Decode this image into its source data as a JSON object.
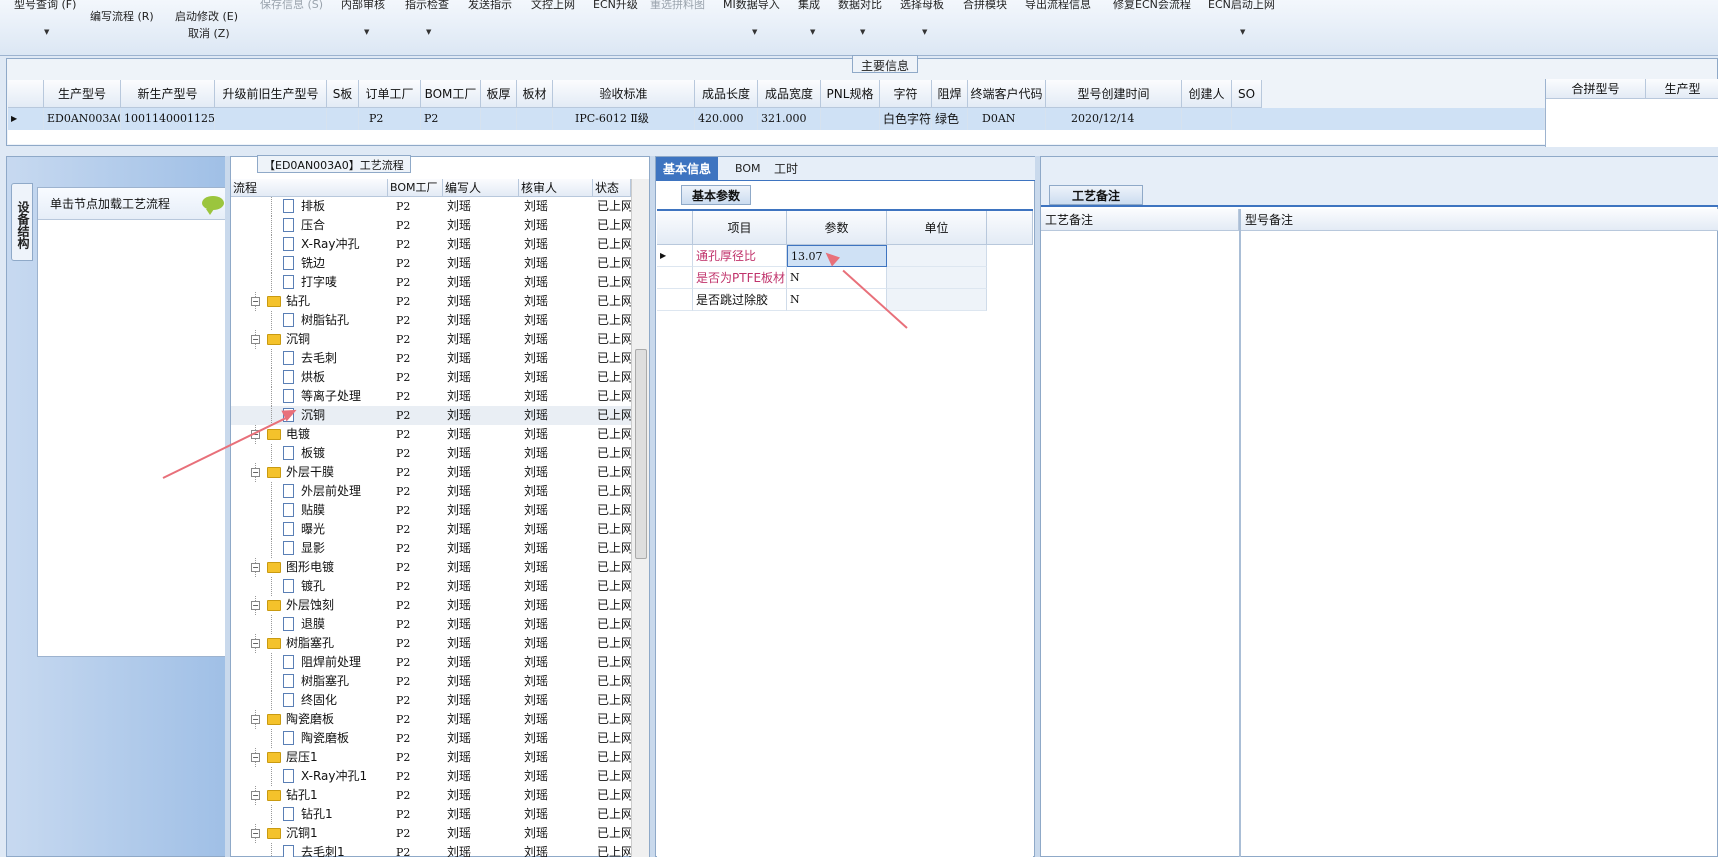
{
  "toolbar": {
    "items": [
      "型号查询 (F)",
      "编写流程 (R)",
      "启动修改 (E)",
      "取消 (Z)",
      "保存信息 (S)",
      "内部审核",
      "指示检查",
      "发送指示",
      "文控上网",
      "ECN升级",
      "重选拼料图",
      "MI数据导入",
      "集成",
      "数据对比",
      "选择母板",
      "合拼模块",
      "导出流程信息",
      "修复ECN会流程",
      "ECN启动上网"
    ]
  },
  "main_info": {
    "title": "主要信息",
    "columns": [
      "生产型号",
      "新生产型号",
      "升级前旧生产型号",
      "S板",
      "订单工厂",
      "BOM工厂",
      "板厚",
      "板材",
      "验收标准",
      "成品长度",
      "成品宽度",
      "PNL规格",
      "字符",
      "阻焊",
      "终端客户代码",
      "型号创建时间",
      "创建人",
      "SO"
    ],
    "row": [
      "ED0AN003A0",
      "10011400011252",
      "",
      "",
      "P2",
      "P2",
      "",
      "",
      "IPC-6012 Ⅱ级",
      "420.000",
      "321.000",
      "",
      "白色字符",
      "绿色",
      "D0AN",
      "2020/12/14",
      "",
      ""
    ],
    "merge_columns": [
      "合拼型号",
      "生产型"
    ]
  },
  "left_panel": {
    "vertical_tab": "设备结构",
    "load_hint": "单击节点加载工艺流程"
  },
  "tree": {
    "title": "【ED0AN003A0】工艺流程",
    "columns": [
      "流程",
      "BOM工厂",
      "编写人",
      "核审人",
      "状态"
    ],
    "rows": [
      {
        "name": "排板",
        "type": "doc",
        "bom": "P2",
        "author": "刘瑶",
        "reviewer": "刘瑶",
        "status": "已上网"
      },
      {
        "name": "压合",
        "type": "doc",
        "bom": "P2",
        "author": "刘瑶",
        "reviewer": "刘瑶",
        "status": "已上网"
      },
      {
        "name": "X-Ray冲孔",
        "type": "doc",
        "bom": "P2",
        "author": "刘瑶",
        "reviewer": "刘瑶",
        "status": "已上网"
      },
      {
        "name": "铣边",
        "type": "doc",
        "bom": "P2",
        "author": "刘瑶",
        "reviewer": "刘瑶",
        "status": "已上网"
      },
      {
        "name": "打字唛",
        "type": "doc",
        "bom": "P2",
        "author": "刘瑶",
        "reviewer": "刘瑶",
        "status": "已上网"
      },
      {
        "name": "钻孔",
        "type": "folder",
        "bom": "P2",
        "author": "刘瑶",
        "reviewer": "刘瑶",
        "status": "已上网"
      },
      {
        "name": "树脂钻孔",
        "type": "doc",
        "bom": "P2",
        "author": "刘瑶",
        "reviewer": "刘瑶",
        "status": "已上网"
      },
      {
        "name": "沉铜",
        "type": "folder",
        "bom": "P2",
        "author": "刘瑶",
        "reviewer": "刘瑶",
        "status": "已上网"
      },
      {
        "name": "去毛刺",
        "type": "doc",
        "bom": "P2",
        "author": "刘瑶",
        "reviewer": "刘瑶",
        "status": "已上网"
      },
      {
        "name": "烘板",
        "type": "doc",
        "bom": "P2",
        "author": "刘瑶",
        "reviewer": "刘瑶",
        "status": "已上网"
      },
      {
        "name": "等离子处理",
        "type": "doc",
        "bom": "P2",
        "author": "刘瑶",
        "reviewer": "刘瑶",
        "status": "已上网"
      },
      {
        "name": "沉铜",
        "type": "doc",
        "bom": "P2",
        "author": "刘瑶",
        "reviewer": "刘瑶",
        "status": "已上网"
      },
      {
        "name": "电镀",
        "type": "folder",
        "bom": "P2",
        "author": "刘瑶",
        "reviewer": "刘瑶",
        "status": "已上网"
      },
      {
        "name": "板镀",
        "type": "doc",
        "bom": "P2",
        "author": "刘瑶",
        "reviewer": "刘瑶",
        "status": "已上网"
      },
      {
        "name": "外层干膜",
        "type": "folder",
        "bom": "P2",
        "author": "刘瑶",
        "reviewer": "刘瑶",
        "status": "已上网"
      },
      {
        "name": "外层前处理",
        "type": "doc",
        "bom": "P2",
        "author": "刘瑶",
        "reviewer": "刘瑶",
        "status": "已上网"
      },
      {
        "name": "贴膜",
        "type": "doc",
        "bom": "P2",
        "author": "刘瑶",
        "reviewer": "刘瑶",
        "status": "已上网"
      },
      {
        "name": "曝光",
        "type": "doc",
        "bom": "P2",
        "author": "刘瑶",
        "reviewer": "刘瑶",
        "status": "已上网"
      },
      {
        "name": "显影",
        "type": "doc",
        "bom": "P2",
        "author": "刘瑶",
        "reviewer": "刘瑶",
        "status": "已上网"
      },
      {
        "name": "图形电镀",
        "type": "folder",
        "bom": "P2",
        "author": "刘瑶",
        "reviewer": "刘瑶",
        "status": "已上网"
      },
      {
        "name": "镀孔",
        "type": "doc",
        "bom": "P2",
        "author": "刘瑶",
        "reviewer": "刘瑶",
        "status": "已上网"
      },
      {
        "name": "外层蚀刻",
        "type": "folder",
        "bom": "P2",
        "author": "刘瑶",
        "reviewer": "刘瑶",
        "status": "已上网"
      },
      {
        "name": "退膜",
        "type": "doc",
        "bom": "P2",
        "author": "刘瑶",
        "reviewer": "刘瑶",
        "status": "已上网"
      },
      {
        "name": "树脂塞孔",
        "type": "folder",
        "bom": "P2",
        "author": "刘瑶",
        "reviewer": "刘瑶",
        "status": "已上网"
      },
      {
        "name": "阻焊前处理",
        "type": "doc",
        "bom": "P2",
        "author": "刘瑶",
        "reviewer": "刘瑶",
        "status": "已上网"
      },
      {
        "name": "树脂塞孔",
        "type": "doc",
        "bom": "P2",
        "author": "刘瑶",
        "reviewer": "刘瑶",
        "status": "已上网"
      },
      {
        "name": "终固化",
        "type": "doc",
        "bom": "P2",
        "author": "刘瑶",
        "reviewer": "刘瑶",
        "status": "已上网"
      },
      {
        "name": "陶瓷磨板",
        "type": "folder",
        "bom": "P2",
        "author": "刘瑶",
        "reviewer": "刘瑶",
        "status": "已上网"
      },
      {
        "name": "陶瓷磨板",
        "type": "doc",
        "bom": "P2",
        "author": "刘瑶",
        "reviewer": "刘瑶",
        "status": "已上网"
      },
      {
        "name": "层压1",
        "type": "folder",
        "bom": "P2",
        "author": "刘瑶",
        "reviewer": "刘瑶",
        "status": "已上网"
      },
      {
        "name": "X-Ray冲孔1",
        "type": "doc",
        "bom": "P2",
        "author": "刘瑶",
        "reviewer": "刘瑶",
        "status": "已上网"
      },
      {
        "name": "钻孔1",
        "type": "folder",
        "bom": "P2",
        "author": "刘瑶",
        "reviewer": "刘瑶",
        "status": "已上网"
      },
      {
        "name": "钻孔1",
        "type": "doc",
        "bom": "P2",
        "author": "刘瑶",
        "reviewer": "刘瑶",
        "status": "已上网"
      },
      {
        "name": "沉铜1",
        "type": "folder",
        "bom": "P2",
        "author": "刘瑶",
        "reviewer": "刘瑶",
        "status": "已上网"
      },
      {
        "name": "去毛刺1",
        "type": "doc",
        "bom": "P2",
        "author": "刘瑶",
        "reviewer": "刘瑶",
        "status": "已上网"
      }
    ],
    "selected_index": 11
  },
  "right_panel": {
    "tabs": [
      "基本信息",
      "BOM",
      "工时"
    ],
    "active_tab": 0,
    "sub_tab": "基本参数",
    "param_columns": [
      "项目",
      "参数",
      "单位"
    ],
    "params": [
      {
        "item": "通孔厚径比",
        "value": "13.07",
        "unit": ""
      },
      {
        "item": "是否为PTFE板材",
        "value": "N",
        "unit": ""
      },
      {
        "item": "是否跳过除胶",
        "value": "N",
        "unit": ""
      }
    ]
  },
  "notes_panel": {
    "tab": "工艺备注",
    "columns": [
      "工艺备注",
      "型号备注"
    ]
  },
  "colors": {
    "accent": "#3e74c0",
    "selection": "#cfe1f5",
    "annotation_arrow": "#e8707a",
    "param_highlight": "#c0336b"
  }
}
